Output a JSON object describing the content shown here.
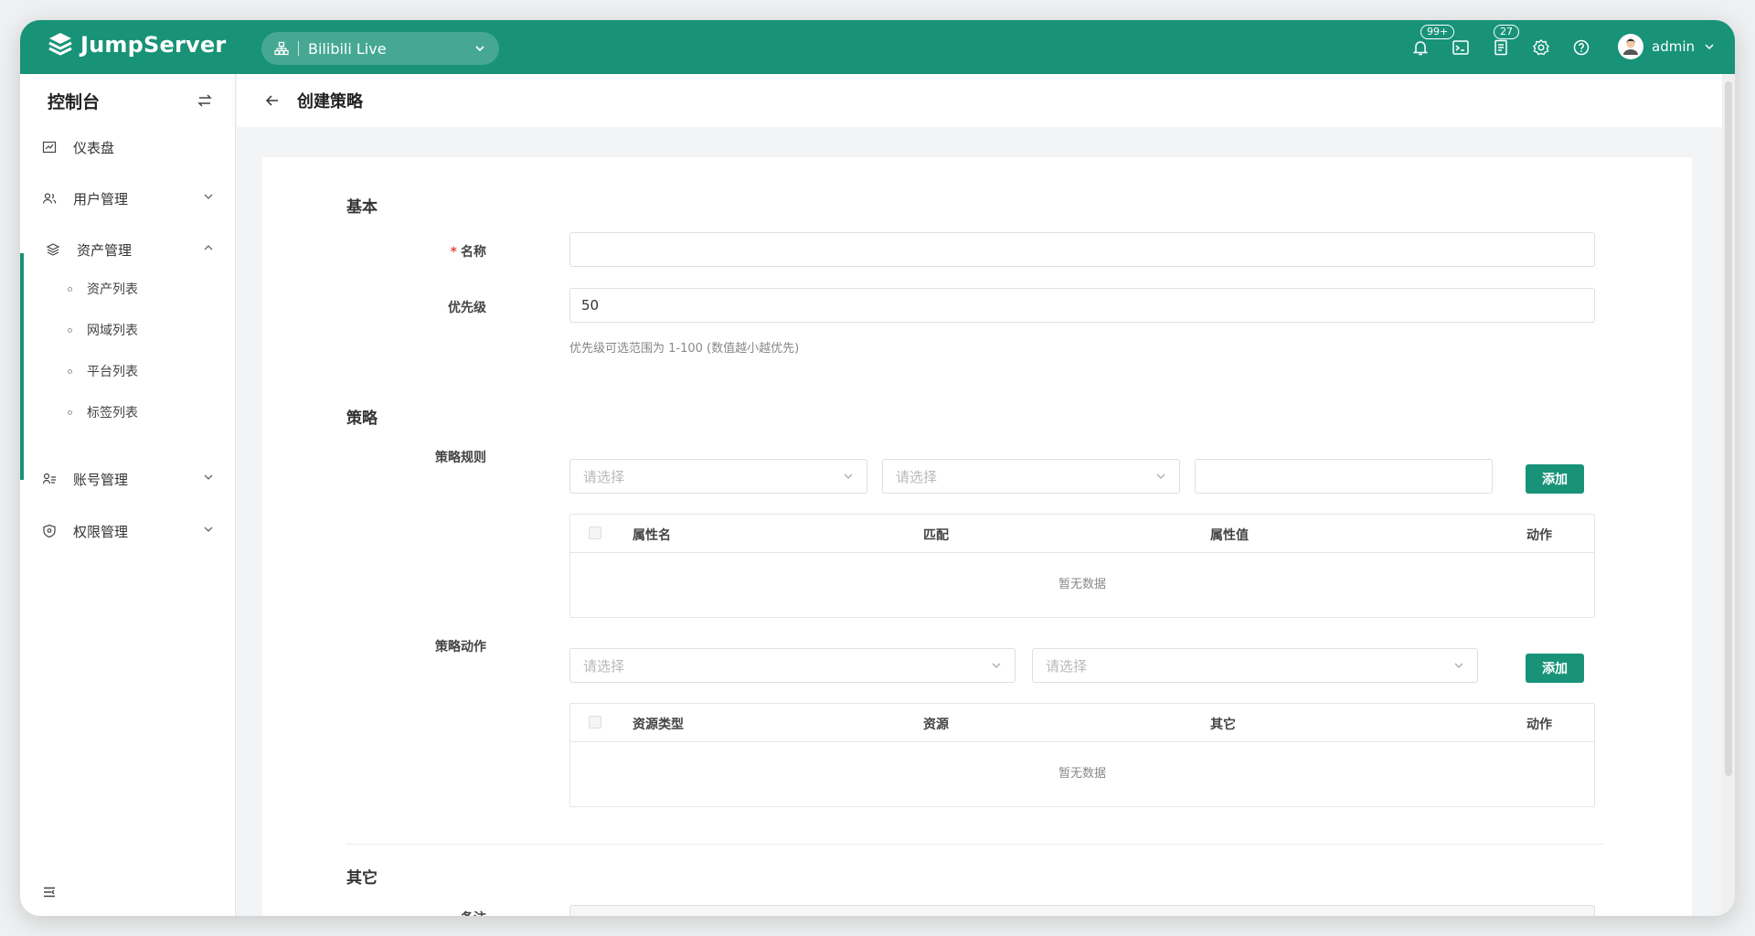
{
  "header": {
    "brand": "JumpServer",
    "org": "Bilibili Live",
    "notifications_badge": "99+",
    "tickets_badge": "27",
    "user": "admin"
  },
  "sidebar": {
    "title": "控制台",
    "items": [
      {
        "label": "仪表盘"
      },
      {
        "label": "用户管理"
      },
      {
        "label": "资产管理"
      },
      {
        "label": "账号管理"
      },
      {
        "label": "权限管理"
      }
    ],
    "asset_sub": [
      {
        "label": "资产列表"
      },
      {
        "label": "网域列表"
      },
      {
        "label": "平台列表"
      },
      {
        "label": "标签列表"
      }
    ]
  },
  "page": {
    "title": "创建策略"
  },
  "form": {
    "section_basic": "基本",
    "name_label": "名称",
    "name_value": "",
    "priority_label": "优先级",
    "priority_value": "50",
    "priority_hint": "优先级可选范围为 1-100 (数值越小越优先)",
    "section_policy": "策略",
    "rule_label": "策略规则",
    "select_placeholder": "请选择",
    "add_label": "添加",
    "rule_columns": [
      "属性名",
      "匹配",
      "属性值",
      "动作"
    ],
    "empty_text": "暂无数据",
    "action_label": "策略动作",
    "action_columns": [
      "资源类型",
      "资源",
      "其它",
      "动作"
    ],
    "section_other": "其它",
    "comment_label": "备注"
  },
  "colors": {
    "brand": "#189378"
  }
}
